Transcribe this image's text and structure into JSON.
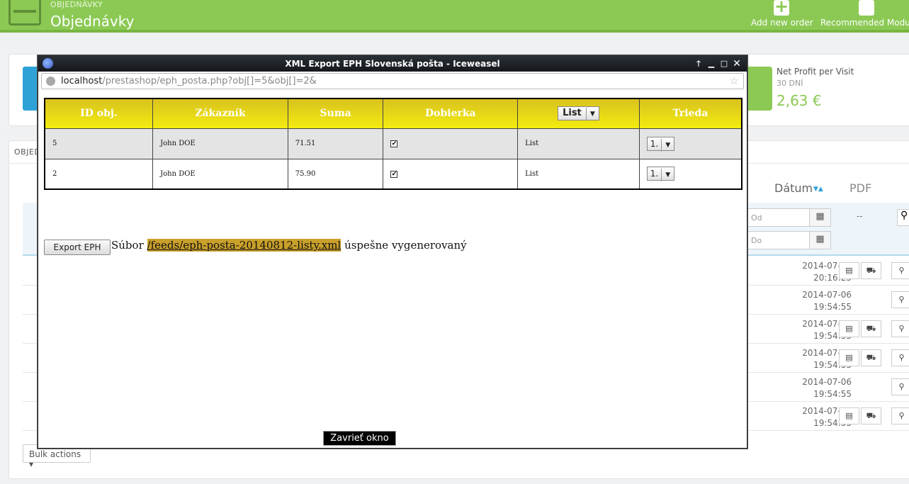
{
  "header": {
    "breadcrumb": "OBJEDNÁVKY",
    "title": "Objednávky",
    "add_order": "Add new order",
    "recommended": "Recommended Module"
  },
  "kpi": {
    "title": "Net Profit per Visit",
    "period": "30 DNÍ",
    "value": "2,63 €"
  },
  "orders": {
    "tab_label": "OBJED",
    "col_date": "Dátum",
    "col_pdf": "PDF",
    "filter_from": "Od",
    "filter_to": "Do",
    "dash": "--",
    "rows": [
      {
        "date": "2014-07-06",
        "time": "20:16:23",
        "has_docs": true
      },
      {
        "date": "2014-07-06",
        "time": "19:54:55",
        "has_docs": false
      },
      {
        "date": "2014-07-06",
        "time": "19:54:55",
        "has_docs": true
      },
      {
        "date": "2014-07-06",
        "time": "19:54:55",
        "has_docs": true
      },
      {
        "date": "2014-07-06",
        "time": "19:54:55",
        "has_docs": false
      },
      {
        "date": "2014-07-06",
        "time": "19:54:55",
        "has_docs": true
      }
    ],
    "bulk_actions": "Bulk actions"
  },
  "popup": {
    "window_title": "XML Export EPH Slovenská pošta - Iceweasel",
    "url_host": "localhost",
    "url_path": "/prestashop/eph_posta.php?obj[]=5&obj[]=2&",
    "table": {
      "headers": [
        "ID obj.",
        "Zákazník",
        "Suma",
        "Dobierka",
        "",
        "Trieda"
      ],
      "header_select": "List",
      "rows": [
        {
          "id": "5",
          "customer": "John DOE",
          "sum": "71.51",
          "cod": true,
          "type": "List",
          "class": "1."
        },
        {
          "id": "2",
          "customer": "John DOE",
          "sum": "75.90",
          "cod": true,
          "type": "List",
          "class": "1."
        }
      ]
    },
    "export_button": "Export EPH",
    "msg_prefix": "Súbor",
    "msg_file": "/feeds/eph-posta-20140812-listy.xml",
    "msg_suffix": "úspešne vygenerovaný",
    "close_button": "Zavrieť okno"
  }
}
